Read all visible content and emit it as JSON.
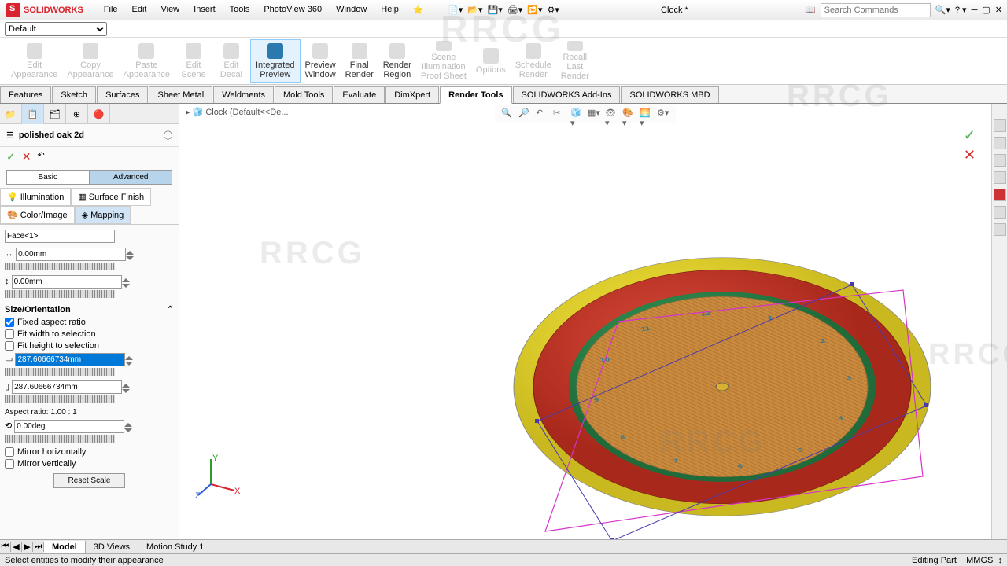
{
  "app": {
    "name": "SOLIDWORKS",
    "doc": "Clock *",
    "search_ph": "Search Commands"
  },
  "menu": [
    "File",
    "Edit",
    "View",
    "Insert",
    "Tools",
    "PhotoView 360",
    "Window",
    "Help"
  ],
  "qat": {
    "config": "Default"
  },
  "ribbon": [
    {
      "l1": "Edit",
      "l2": "Appearance",
      "en": false
    },
    {
      "l1": "Copy",
      "l2": "Appearance",
      "en": false
    },
    {
      "l1": "Paste",
      "l2": "Appearance",
      "en": false
    },
    {
      "l1": "Edit",
      "l2": "Scene",
      "en": false
    },
    {
      "l1": "Edit",
      "l2": "Decal",
      "en": false
    },
    {
      "l1": "Integrated",
      "l2": "Preview",
      "en": true,
      "active": true
    },
    {
      "l1": "Preview",
      "l2": "Window",
      "en": true
    },
    {
      "l1": "Final",
      "l2": "Render",
      "en": true
    },
    {
      "l1": "Render",
      "l2": "Region",
      "en": true
    },
    {
      "l1": "Scene",
      "l2": "Illumination",
      "l3": "Proof Sheet",
      "en": false
    },
    {
      "l1": "Options",
      "l2": "",
      "en": false
    },
    {
      "l1": "Schedule",
      "l2": "Render",
      "en": false
    },
    {
      "l1": "Recall",
      "l2": "Last",
      "l3": "Render",
      "en": false
    }
  ],
  "tabs": [
    "Features",
    "Sketch",
    "Surfaces",
    "Sheet Metal",
    "Weldments",
    "Mold Tools",
    "Evaluate",
    "DimXpert",
    "Render Tools",
    "SOLIDWORKS Add-Ins",
    "SOLIDWORKS MBD"
  ],
  "tabs_active": 8,
  "panel": {
    "title": "polished oak 2d",
    "modes": {
      "basic": "Basic",
      "adv": "Advanced"
    },
    "cats": [
      "Illumination",
      "Surface Finish",
      "Color/Image",
      "Mapping"
    ],
    "face": "Face<1>",
    "offset1": "0.00mm",
    "offset2": "0.00mm",
    "section": "Size/Orientation",
    "fixed": "Fixed aspect ratio",
    "fitw": "Fit width to selection",
    "fith": "Fit height to selection",
    "w": "287.60666734mm",
    "h": "287.60666734mm",
    "aspect": "Aspect ratio: 1.00 : 1",
    "rot": "0.00deg",
    "mh": "Mirror horizontally",
    "mv": "Mirror vertically",
    "reset": "Reset Scale"
  },
  "vp": {
    "breadcrumb": "Clock  (Default<<De..."
  },
  "bottom": {
    "tabs": [
      "Model",
      "3D Views",
      "Motion Study 1"
    ]
  },
  "status": {
    "left": "Select entities to modify their appearance",
    "right1": "Editing Part",
    "right2": "MMGS"
  },
  "wm": "RRCG"
}
